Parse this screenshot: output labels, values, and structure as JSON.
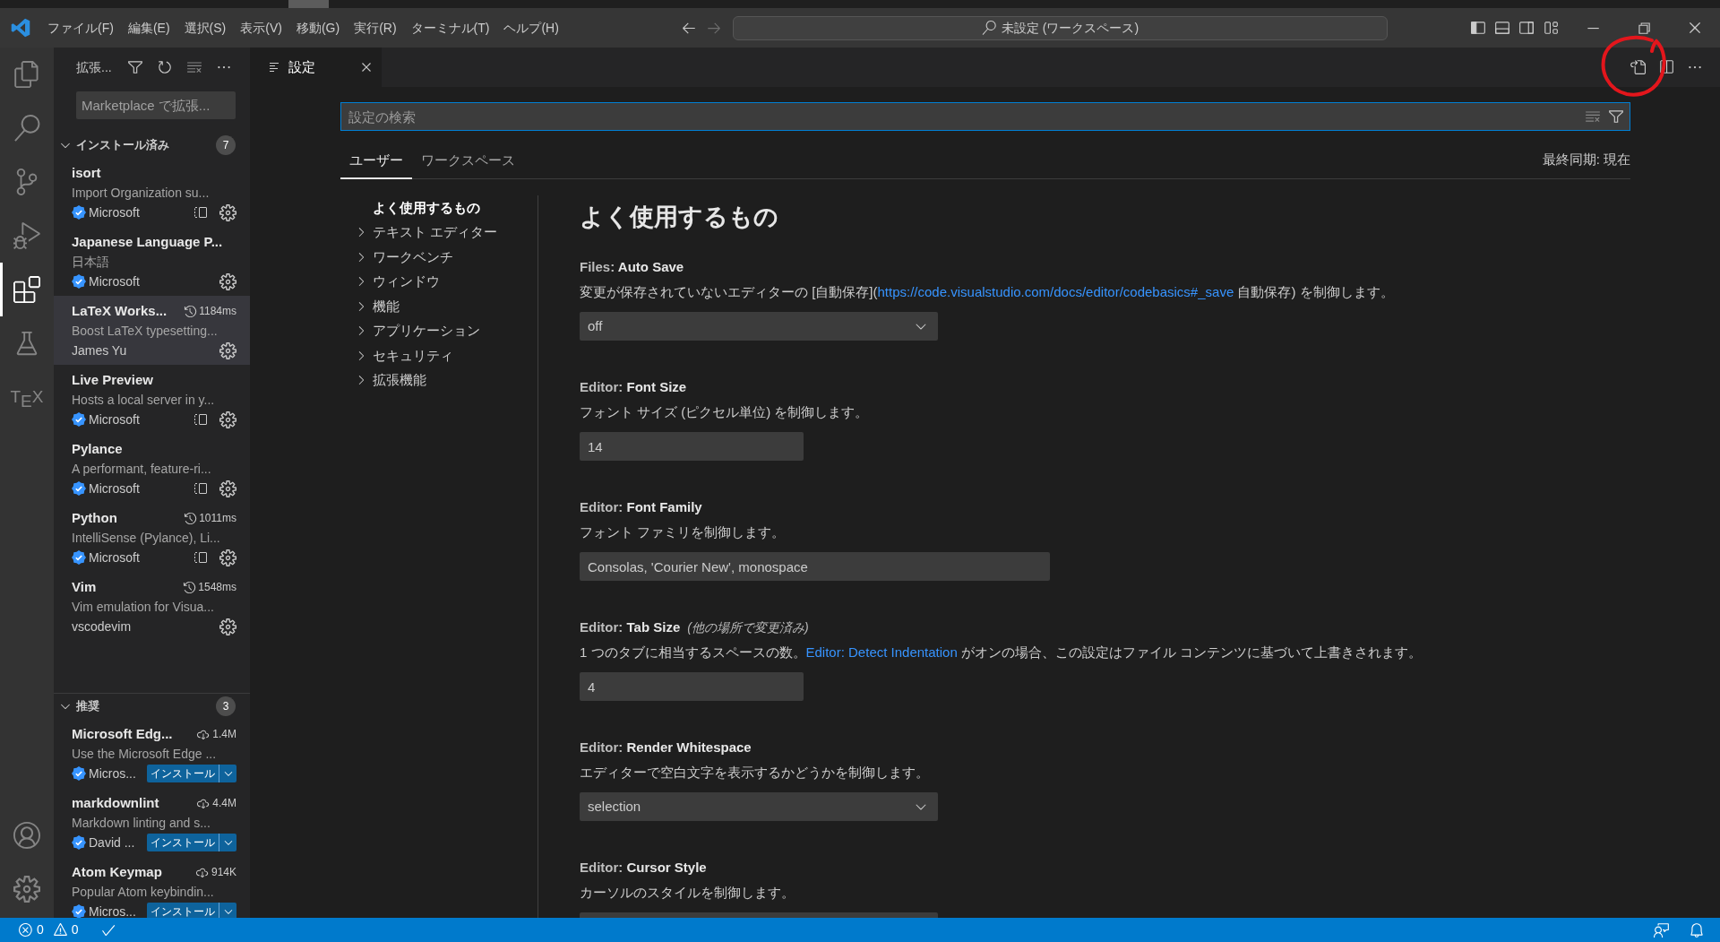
{
  "menu_bar": {
    "items": [
      "ファイル(F)",
      "編集(E)",
      "選択(S)",
      "表示(V)",
      "移動(G)",
      "実行(R)",
      "ターミナル(T)",
      "ヘルプ(H)"
    ]
  },
  "navigation": {
    "back": {
      "disabled": false
    },
    "forward": {
      "disabled": true
    }
  },
  "command_center": {
    "text": "未設定 (ワークスペース)"
  },
  "layout_controls": [
    {
      "kind": "sidebar-left",
      "on": true
    },
    {
      "kind": "panel",
      "on": false
    },
    {
      "kind": "sidebar-right",
      "on": false
    },
    {
      "kind": "customize"
    }
  ],
  "activity_bar": {
    "items": [
      {
        "kind": "explorer",
        "selected": false
      },
      {
        "kind": "search",
        "selected": false
      },
      {
        "kind": "source-control",
        "selected": false
      },
      {
        "kind": "run-debug",
        "selected": false
      },
      {
        "kind": "extensions",
        "selected": true
      },
      {
        "kind": "testing",
        "selected": false
      },
      {
        "kind": "tex",
        "label": "T$_{E}$X",
        "selected": false
      }
    ],
    "bottom_items": [
      {
        "kind": "account"
      },
      {
        "kind": "manage"
      }
    ]
  },
  "sidebar": {
    "title": "拡張...",
    "search": {
      "placeholder": "Marketplace で拡張..."
    },
    "sections": [
      {
        "kind": "installed",
        "title": "インストール済み",
        "count": "7",
        "expanded": true,
        "items": [
          {
            "name": "isort",
            "description": "Import Organization su...",
            "publisher": "Microsoft",
            "verified": true,
            "layout_icon": true,
            "selected": false
          },
          {
            "name": "Japanese Language P...",
            "description": "日本語",
            "publisher": "Microsoft",
            "verified": true,
            "layout_icon": false,
            "selected": false
          },
          {
            "name": "LaTeX Works...",
            "timing": "1184ms",
            "description": "Boost LaTeX typesetting...",
            "publisher": "James Yu",
            "verified": false,
            "layout_icon": false,
            "selected": true
          },
          {
            "name": "Live Preview",
            "description": "Hosts a local server in y...",
            "publisher": "Microsoft",
            "verified": true,
            "layout_icon": true,
            "selected": false
          },
          {
            "name": "Pylance",
            "description": "A performant, feature-ri...",
            "publisher": "Microsoft",
            "verified": true,
            "layout_icon": true,
            "selected": false
          },
          {
            "name": "Python",
            "timing": "1011ms",
            "description": "IntelliSense (Pylance), Li...",
            "publisher": "Microsoft",
            "verified": true,
            "layout_icon": true,
            "selected": false
          },
          {
            "name": "Vim",
            "timing": "1548ms",
            "description": "Vim emulation for Visua...",
            "publisher": "vscodevim",
            "verified": false,
            "layout_icon": false,
            "selected": false
          }
        ]
      },
      {
        "kind": "recommended",
        "title": "推奨",
        "count": "3",
        "expanded": true,
        "items": [
          {
            "name": "Microsoft Edg...",
            "installs": "1.4M",
            "description": "Use the Microsoft Edge ...",
            "publisher": "Micros...",
            "verified": true,
            "install_label": "インストール",
            "selected": false
          },
          {
            "name": "markdownlint",
            "installs": "4.4M",
            "description": "Markdown linting and s...",
            "publisher": "David ...",
            "verified": true,
            "install_label": "インストール",
            "selected": false
          },
          {
            "name": "Atom Keymap",
            "installs": "914K",
            "description": "Popular Atom keybindin...",
            "publisher": "Micros...",
            "verified": true,
            "install_label": "インストール",
            "selected": false
          }
        ]
      }
    ]
  },
  "editor": {
    "tabs": [
      {
        "label": "設定",
        "selected": true
      }
    ],
    "settings": {
      "search": {
        "placeholder": "設定の検索"
      },
      "scope_tabs": [
        {
          "label": "ユーザー",
          "selected": true
        },
        {
          "label": "ワークスペース",
          "selected": false
        }
      ],
      "sync_status": "最終同期: 現在",
      "toc": [
        {
          "label": "よく使用するもの",
          "kind": "leaf",
          "selected": true
        },
        {
          "label": "テキスト エディター",
          "kind": "group",
          "selected": false
        },
        {
          "label": "ワークベンチ",
          "kind": "group",
          "selected": false
        },
        {
          "label": "ウィンドウ",
          "kind": "group",
          "selected": false
        },
        {
          "label": "機能",
          "kind": "group",
          "selected": false
        },
        {
          "label": "アプリケーション",
          "kind": "group",
          "selected": false
        },
        {
          "label": "セキュリティ",
          "kind": "group",
          "selected": false
        },
        {
          "label": "拡張機能",
          "kind": "group",
          "selected": false
        }
      ],
      "section_title": "よく使用するもの",
      "items": [
        {
          "category": "Files:",
          "name": "Auto Save",
          "description": [
            {
              "kind": "text",
              "text": "変更が保存されていないエディターの [自動保存]("
            },
            {
              "kind": "link",
              "text": "https://code.visualstudio.com/docs/editor/codebasics#_save"
            },
            {
              "kind": "text",
              "text": " 自動保存) を制御します。"
            }
          ],
          "control": {
            "kind": "select",
            "value": "off"
          }
        },
        {
          "category": "Editor:",
          "name": "Font Size",
          "description": [
            {
              "kind": "text",
              "text": "フォント サイズ (ピクセル単位) を制御します。"
            }
          ],
          "control": {
            "kind": "number-input",
            "value": "14"
          }
        },
        {
          "category": "Editor:",
          "name": "Font Family",
          "description": [
            {
              "kind": "text",
              "text": "フォント ファミリを制御します。"
            }
          ],
          "control": {
            "kind": "text-input",
            "value": "Consolas, 'Courier New', monospace"
          }
        },
        {
          "category": "Editor:",
          "name": "Tab Size",
          "modified_note": "(他の場所で変更済み)",
          "description": [
            {
              "kind": "text",
              "text": "1 つのタブに相当するスペースの数。"
            },
            {
              "kind": "link",
              "text": "Editor: Detect Indentation"
            },
            {
              "kind": "text",
              "text": " がオンの場合、この設定はファイル コンテンツに基づいて上書きされます。"
            }
          ],
          "control": {
            "kind": "number-input",
            "value": "4"
          }
        },
        {
          "category": "Editor:",
          "name": "Render Whitespace",
          "description": [
            {
              "kind": "text",
              "text": "エディターで空白文字を表示するかどうかを制御します。"
            }
          ],
          "control": {
            "kind": "select",
            "value": "selection"
          }
        },
        {
          "category": "Editor:",
          "name": "Cursor Style",
          "description": [
            {
              "kind": "text",
              "text": "カーソルのスタイルを制御します。"
            }
          ],
          "control": {
            "kind": "select"
          }
        }
      ]
    }
  },
  "status_bar": {
    "errors": "0",
    "warnings": "0"
  }
}
